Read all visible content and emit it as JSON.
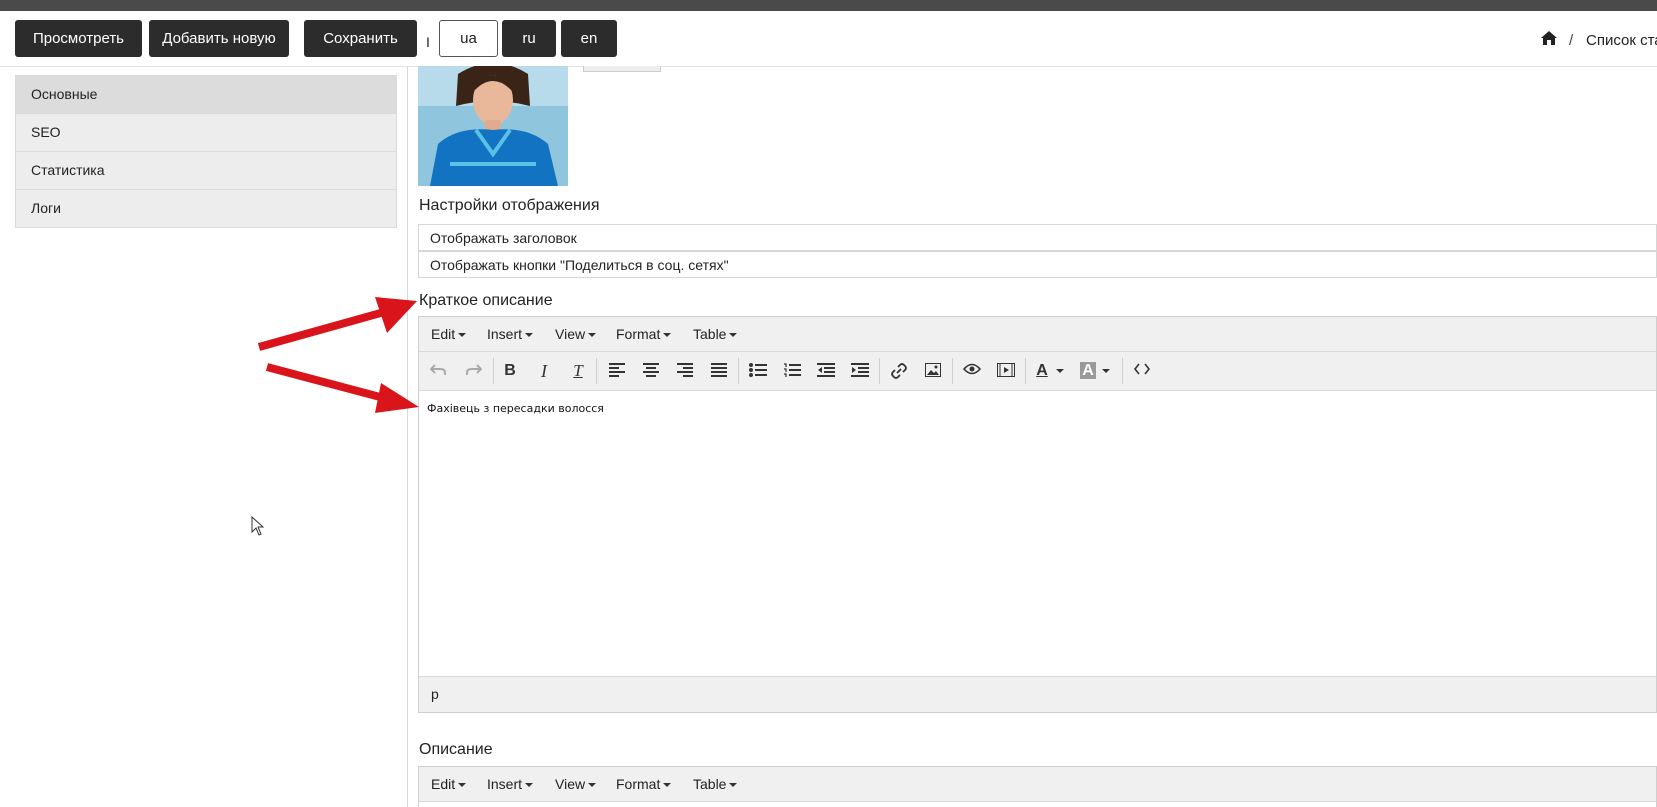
{
  "toolbar": {
    "view_label": "Просмотреть",
    "add_new_label": "Добавить новую",
    "save_label": "Сохранить",
    "separator": "I",
    "languages": [
      "ua",
      "ru",
      "en"
    ],
    "active_language": "ua"
  },
  "breadcrumb": {
    "separator": "/",
    "current": "Список ста"
  },
  "sidebar": {
    "items": [
      {
        "label": "Основные",
        "active": true
      },
      {
        "label": "SEO",
        "active": false
      },
      {
        "label": "Статистика",
        "active": false
      },
      {
        "label": "Логи",
        "active": false
      }
    ]
  },
  "display_settings": {
    "title": "Настройки отображения",
    "options": [
      "Отображать заголовок",
      "Отображать кнопки \"Поделиться в соц. сетях\""
    ]
  },
  "short_description": {
    "title": "Краткое описание",
    "content": "Фахівець з пересадки волосся",
    "path": "p"
  },
  "description": {
    "title": "Описание"
  },
  "editor_menu": [
    "Edit",
    "Insert",
    "View",
    "Format",
    "Table"
  ],
  "colors": {
    "dark_button": "#2c2c2c",
    "arrow": "#d9141b",
    "editor_bar": "#f0f0f0"
  }
}
